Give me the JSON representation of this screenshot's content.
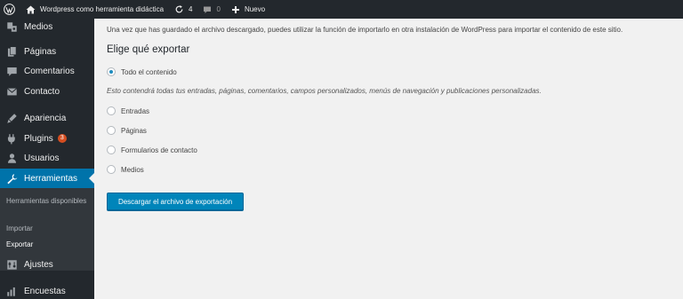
{
  "adminbar": {
    "site_name": "Wordpress como herramienta didáctica",
    "updates_count": "4",
    "comments_count": "0",
    "new_label": "Nuevo"
  },
  "sidebar": {
    "items": [
      {
        "label": "Medios",
        "icon": "media-icon"
      },
      {
        "label": "Páginas",
        "icon": "pages-icon"
      },
      {
        "label": "Comentarios",
        "icon": "comments-icon"
      },
      {
        "label": "Contacto",
        "icon": "mail-icon"
      },
      {
        "label": "Apariencia",
        "icon": "appearance-icon"
      },
      {
        "label": "Plugins",
        "icon": "plugins-icon",
        "badge": "3"
      },
      {
        "label": "Usuarios",
        "icon": "users-icon"
      },
      {
        "label": "Herramientas",
        "icon": "tools-icon"
      },
      {
        "label": "Ajustes",
        "icon": "settings-icon"
      },
      {
        "label": "Encuestas",
        "icon": "polls-icon"
      }
    ],
    "submenu": [
      {
        "label": "Herramientas disponibles"
      },
      {
        "label": "Importar"
      },
      {
        "label": "Exportar"
      }
    ]
  },
  "main": {
    "intro": "Una vez que has guardado el archivo descargado, puedes utilizar la función de importarlo en otra instalación de WordPress para importar el contenido de este sitio.",
    "heading": "Elige qué exportar",
    "all_content_label": "Todo el contenido",
    "description": "Esto contendrá todas tus entradas, páginas, comentarios, campos personalizados, menús de navegación y publicaciones personalizadas.",
    "options": [
      {
        "label": "Entradas"
      },
      {
        "label": "Páginas"
      },
      {
        "label": "Formularios de contacto"
      },
      {
        "label": "Medios"
      }
    ],
    "button_label": "Descargar el archivo de exportación"
  },
  "colors": {
    "admin_bg": "#23282d",
    "accent": "#0073aa",
    "button": "#0085ba",
    "badge": "#d54e21",
    "content_bg": "#f1f1f1"
  }
}
